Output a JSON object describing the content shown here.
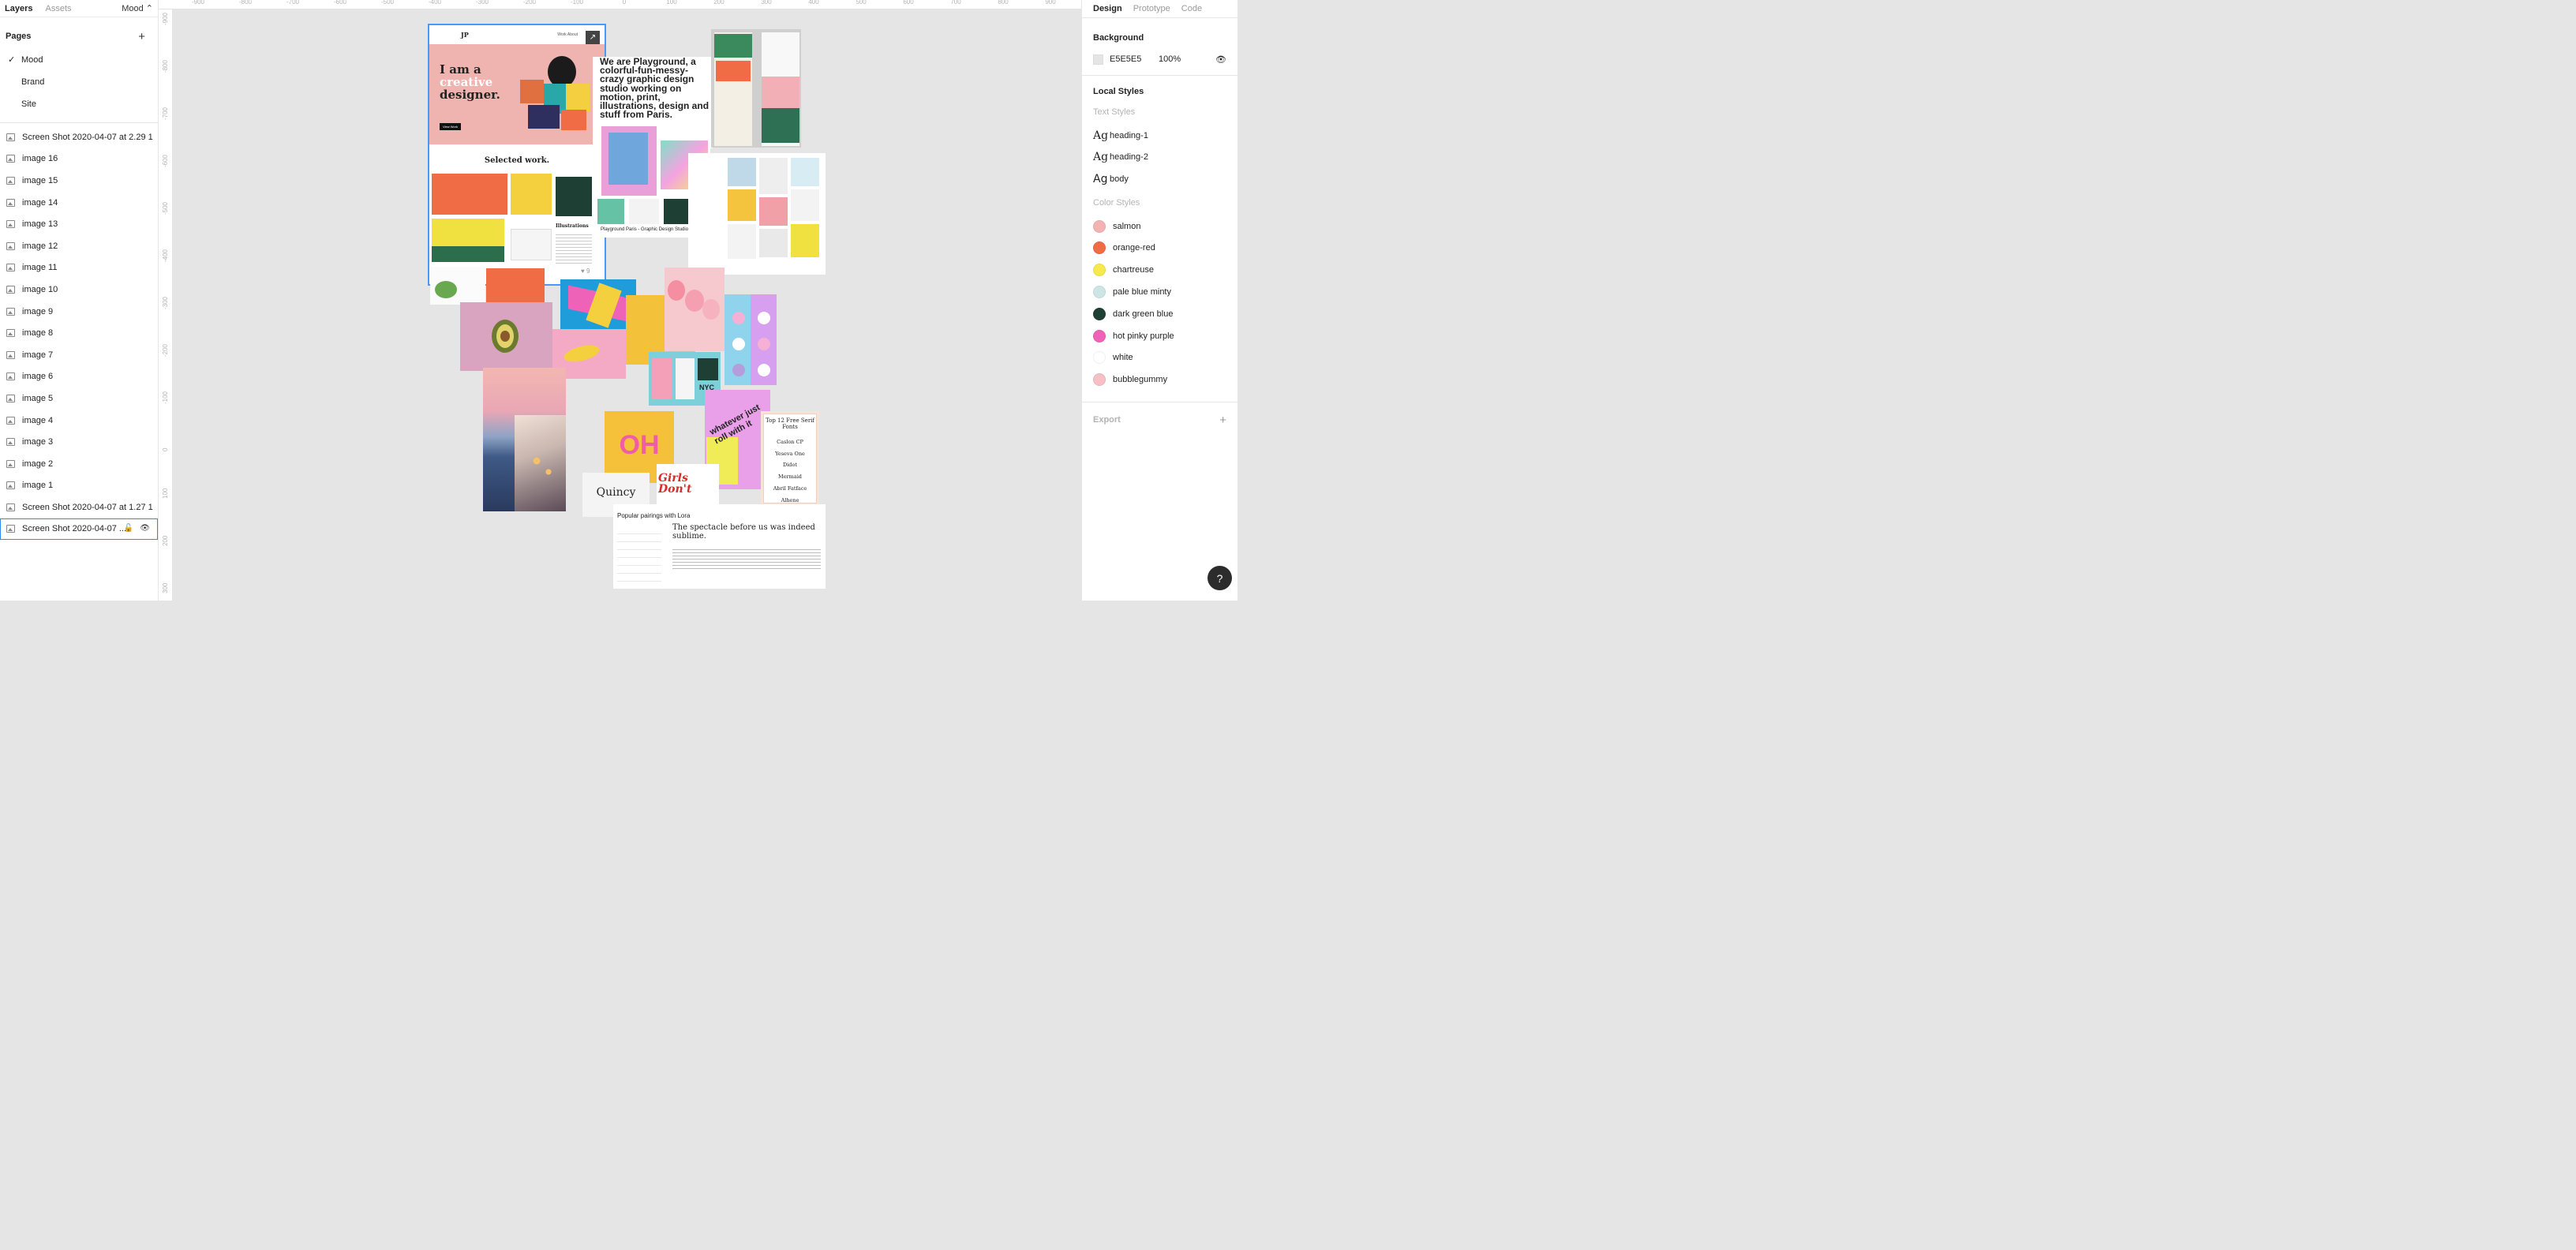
{
  "left_panel": {
    "tabs": [
      "Layers",
      "Assets"
    ],
    "current_page": "Mood",
    "pages_title": "Pages",
    "pages": [
      {
        "label": "Mood",
        "active": true
      },
      {
        "label": "Brand",
        "active": false
      },
      {
        "label": "Site",
        "active": false
      }
    ],
    "layers": [
      "Screen Shot 2020-04-07 at 2.29 1",
      "image 16",
      "image 15",
      "image 14",
      "image 13",
      "image 12",
      "image 11",
      "image 10",
      "image 9",
      "image 8",
      "image 7",
      "image 6",
      "image 5",
      "image 4",
      "image 3",
      "image 2",
      "image 1",
      "Screen Shot 2020-04-07 at 1.27 1",
      "Screen Shot 2020-04-07 ..."
    ]
  },
  "rulers": {
    "top": [
      "-900",
      "-800",
      "-700",
      "-600",
      "-500",
      "-400",
      "-300",
      "-200",
      "-100",
      "0",
      "100",
      "200",
      "300",
      "400",
      "500",
      "600",
      "700",
      "800",
      "900"
    ],
    "left": [
      "-900",
      "-800",
      "-700",
      "-600",
      "-500",
      "-400",
      "-300",
      "-200",
      "-100",
      "0",
      "100",
      "200",
      "300"
    ]
  },
  "canvas": {
    "site": {
      "logo": "JP",
      "nav": "Work   About",
      "hero_line1": "I am a",
      "hero_line2": "creative",
      "hero_line3": "designer.",
      "cta": "View Work",
      "section": "Selected work.",
      "card_title": "Illustrations",
      "likes": "9"
    },
    "playground": {
      "headline": "We are Playground, a colorful-fun-messy-crazy graphic design studio working on motion, print, illustrations, design and stuff from Paris.",
      "caption": "Playground Paris - Graphic Design Studio"
    },
    "oh": "OH",
    "quincy": "Quincy",
    "girls": "Girls Don't",
    "whatever": "whatever just roll with it",
    "nyc": "NYC",
    "fonts_list": {
      "title": "Top 12 Free Serif Fonts",
      "items": [
        "Caslon CP",
        "Yeseva One",
        "Didot",
        "Mermaid",
        "Abril Fatface",
        "Alhene"
      ]
    },
    "lora": {
      "title": "Popular pairings with Lora",
      "quote": "The spectacle before us was indeed sublime."
    }
  },
  "right_panel": {
    "tabs": [
      "Design",
      "Prototype",
      "Code"
    ],
    "background_title": "Background",
    "bg_hex": "E5E5E5",
    "bg_opacity": "100%",
    "local_styles": "Local Styles",
    "text_styles_title": "Text Styles",
    "text_styles": [
      "heading-1",
      "heading-2",
      "body"
    ],
    "color_styles_title": "Color Styles",
    "colors": [
      {
        "name": "salmon",
        "hex": "#f4b3b3"
      },
      {
        "name": "orange-red",
        "hex": "#ef6c45"
      },
      {
        "name": "chartreuse",
        "hex": "#f6e94c"
      },
      {
        "name": "pale blue minty",
        "hex": "#cde6e5"
      },
      {
        "name": "dark green blue",
        "hex": "#1e4034"
      },
      {
        "name": "hot pinky purple",
        "hex": "#ee63b8"
      },
      {
        "name": "white",
        "hex": "#ffffff"
      },
      {
        "name": "bubblegummy",
        "hex": "#f7c0c6"
      }
    ],
    "export_title": "Export",
    "help": "?"
  }
}
